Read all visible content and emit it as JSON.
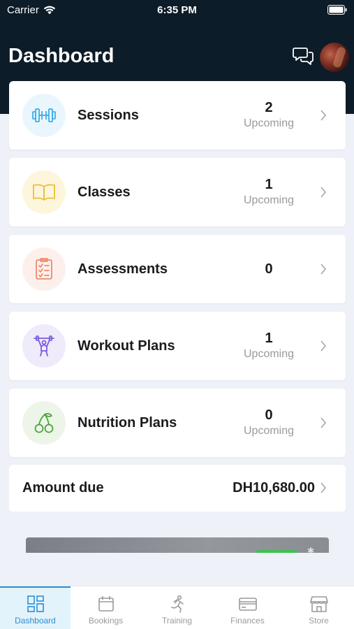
{
  "status_bar": {
    "carrier": "Carrier",
    "time": "6:35 PM"
  },
  "header": {
    "title": "Dashboard",
    "chat_icon": "chat-icon",
    "avatar": "user-avatar"
  },
  "cards": [
    {
      "label": "Sessions",
      "count": "2",
      "sub": "Upcoming",
      "icon": "dumbbell-icon",
      "icon_bg": "#e9f6fd",
      "icon_color": "#3aaee6"
    },
    {
      "label": "Classes",
      "count": "1",
      "sub": "Upcoming",
      "icon": "book-icon",
      "icon_bg": "#fdf6dc",
      "icon_color": "#e8bf3a"
    },
    {
      "label": "Assessments",
      "count": "0",
      "sub": "",
      "icon": "checklist-icon",
      "icon_bg": "#fdf0ec",
      "icon_color": "#ec8a6a"
    },
    {
      "label": "Workout Plans",
      "count": "1",
      "sub": "Upcoming",
      "icon": "barbell-icon",
      "icon_bg": "#efebfb",
      "icon_color": "#7b5ce0"
    },
    {
      "label": "Nutrition Plans",
      "count": "0",
      "sub": "Upcoming",
      "icon": "cherries-icon",
      "icon_bg": "#ecf5e8",
      "icon_color": "#4ea33e"
    }
  ],
  "amount": {
    "label": "Amount due",
    "value": "DH10,680.00"
  },
  "tabs": [
    {
      "label": "Dashboard",
      "icon": "dashboard-grid-icon",
      "active": true
    },
    {
      "label": "Bookings",
      "icon": "calendar-icon",
      "active": false
    },
    {
      "label": "Training",
      "icon": "runner-icon",
      "active": false
    },
    {
      "label": "Finances",
      "icon": "credit-card-icon",
      "active": false
    },
    {
      "label": "Store",
      "icon": "store-icon",
      "active": false
    }
  ],
  "colors": {
    "header_bg": "#0c1c28",
    "accent": "#2a8fd0",
    "page_bg": "#eef1f7"
  }
}
